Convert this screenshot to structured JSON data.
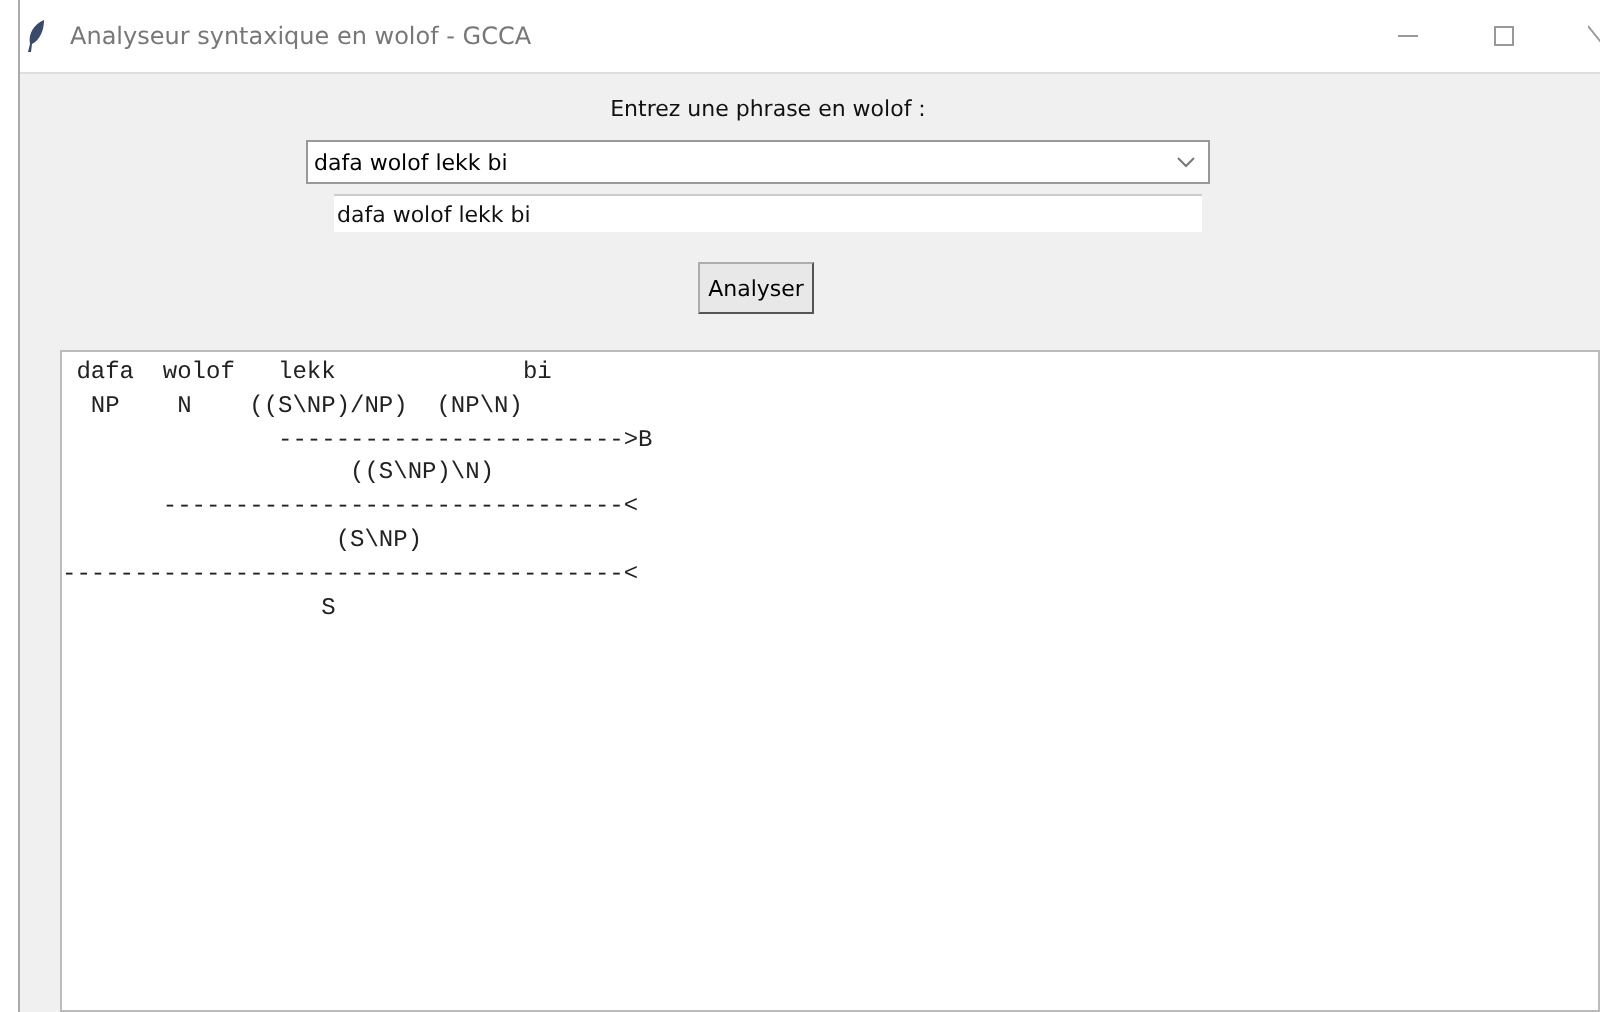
{
  "window": {
    "title": "Analyseur syntaxique en wolof - GCCA"
  },
  "prompt": "Entrez une phrase en wolof :",
  "combo": {
    "value": "dafa wolof lekk bi"
  },
  "entry": {
    "value": "dafa wolof lekk bi"
  },
  "button": "Analyser",
  "output_lines": [
    " dafa  wolof   lekk             bi",
    "  NP    N    ((S\\NP)/NP)  (NP\\N)",
    "               ------------------------>B",
    "                    ((S\\NP)\\N)",
    "       --------------------------------<",
    "                   (S\\NP)",
    "---------------------------------------<",
    "                  S"
  ]
}
